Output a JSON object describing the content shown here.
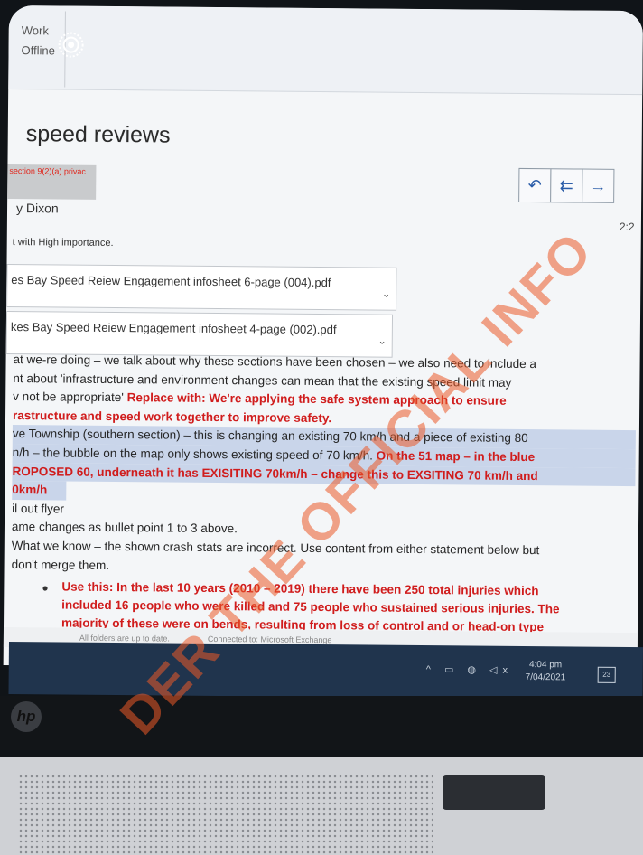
{
  "ribbon": {
    "label_1": "Work",
    "label_2": "Offline"
  },
  "email": {
    "subject": "speed reviews",
    "redaction_note": "section 9(2)(a) privac",
    "sender": "y Dixon",
    "importance": "t with High importance.",
    "time": "2:2",
    "attachments": [
      {
        "name": "es Bay Speed Reiew Engagement infosheet 6-page (004).pdf"
      },
      {
        "name": "kes Bay Speed Reiew Engagement infosheet 4-page (002).pdf"
      }
    ]
  },
  "nav": {
    "reply": "↶",
    "reply_all": "⇇",
    "forward": "→"
  },
  "body": {
    "l1": "at we-re doing – we talk about why these sections have been chosen – we also need to include a",
    "l2": "nt about 'infrastructure and environment changes can mean that the existing speed limit may",
    "l3a": "v not be appropriate' ",
    "l3b": "Replace with: We're applying the safe system approach to ensure",
    "l4": "rastructure and speed work together to improve safety.",
    "l5": "ve Township (southern section) – this is changing an existing 70 km/h and a piece of existing 80",
    "l6a": "n/h – the bubble on the map only shows existing speed of 70 km/h. ",
    "l6b": "On the 51 map – in the blue",
    "l7": "ROPOSED 60, underneath it has EXISITING 70km/h – change this to EXSITING 70 km/h and",
    "l8": "0km/h",
    "l9": "il out flyer",
    "l10": "ame changes as bullet point 1 to 3 above.",
    "l11": "What we know – the shown crash stats are incorrect. Use content from either statement below but",
    "l12": "don't merge them.",
    "b1": "Use this: In the last 10 years (2010 – 2019) there have been 250 total injuries which",
    "b2": "included 16 people who were killed and 75 people who sustained serious injuries. The",
    "b3": "majority of these were on bends, resulting from loss of control and or head-on type"
  },
  "status": {
    "left": "All folders are up to date.",
    "mid": "Connected to: Microsoft Exchange"
  },
  "taskbar": {
    "tray": "^ ▭ ◍ ◁x",
    "time": "4:04 pm",
    "date": "7/04/2021",
    "notif": "23"
  },
  "laptop": {
    "logo": "hp"
  },
  "watermark": "DER THE OFFICIAL INFO",
  "icons": {
    "offline": "offline-target-icon",
    "attachment": "chevron-down-icon",
    "bullet": "bullet-icon"
  },
  "colors": {
    "emphasis_red": "#d01c1c",
    "highlight": "#c9d5ea",
    "taskbar": "#20344d",
    "watermark": "#eb5a28"
  }
}
